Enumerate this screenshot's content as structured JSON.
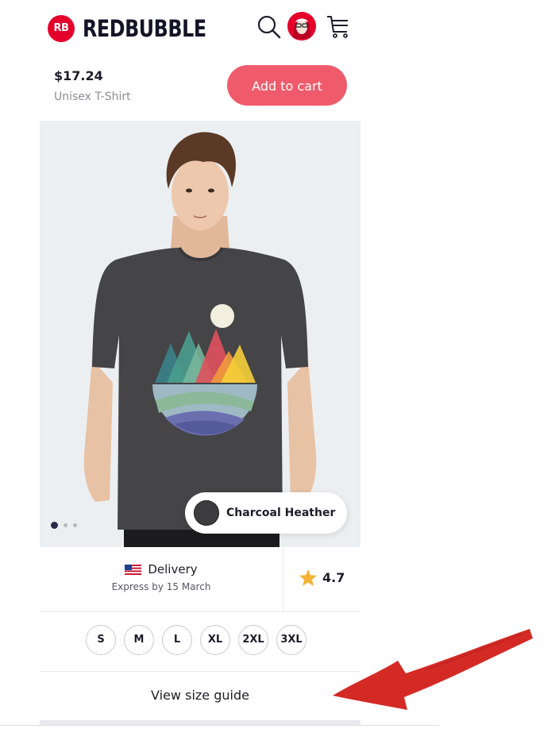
{
  "header": {
    "brand": "REDBUBBLE",
    "brand_badge": "RB",
    "icons": [
      "search-icon",
      "avatar",
      "cart-icon"
    ]
  },
  "sticky_bar": {
    "price": "$17.24",
    "product_type": "Unisex T-Shirt",
    "add_to_cart_label": "Add to cart",
    "accent_color": "#ef5b6b"
  },
  "product_image": {
    "carousel_dots": 3,
    "active_dot": 0,
    "selected_color": "Charcoal Heather",
    "swatch_color": "#3d3d3f"
  },
  "delivery": {
    "label": "Delivery",
    "detail": "Express by 15 March",
    "flag": "us-flag-icon"
  },
  "rating": {
    "value": "4.7",
    "icon": "star-icon",
    "star_color": "#f5b335"
  },
  "sizes": [
    "S",
    "M",
    "L",
    "XL",
    "2XL",
    "3XL"
  ],
  "size_guide": {
    "label": "View size guide"
  },
  "annotation": {
    "icon": "red-arrow-icon",
    "color": "#d42a26"
  }
}
